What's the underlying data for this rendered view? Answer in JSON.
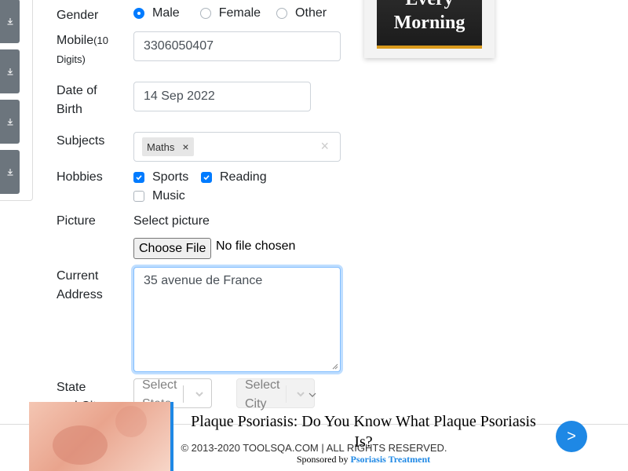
{
  "form": {
    "gender_label": "Gender",
    "gender_options": [
      "Male",
      "Female",
      "Other"
    ],
    "mobile_label": "Mobile",
    "mobile_hint_1": "(10",
    "mobile_hint_2": "Digits)",
    "mobile_value": "3306050407",
    "dob_label_1": "Date of",
    "dob_label_2": "Birth",
    "dob_value": "14 Sep 2022",
    "subjects_label": "Subjects",
    "subject_chip": "Maths",
    "chip_remove": "×",
    "clear_all": "×",
    "hobbies_label": "Hobbies",
    "hobby_sports": "Sports",
    "hobby_reading": "Reading",
    "hobby_music": "Music",
    "picture_label": "Picture",
    "picture_hint": "Select picture",
    "file_button": "Choose File",
    "file_status": "No file chosen",
    "address_label_1": "Current",
    "address_label_2": "Address",
    "address_value": "35 avenue de France",
    "state_label": "State",
    "state_label_2": "and City",
    "state_placeholder_1": "Select",
    "state_placeholder_2": "State",
    "city_placeholder_1": "Select",
    "city_placeholder_2": "City"
  },
  "ad_top": {
    "line1": "Every",
    "line2": "Morning"
  },
  "footer": {
    "copyright": "© 2013-2020 TOOLSQA.COM | ALL RIGHTS RESERVED."
  },
  "ad_bottom": {
    "title": "Plaque Psoriasis: Do You Know What Plaque Psoriasis Is?",
    "sponsored_prefix": "Sponsored by",
    "sponsor": "Psoriasis Treatment",
    "next": ">"
  },
  "colors": {
    "accent": "#007bff",
    "sidebar_button": "#6c757d",
    "ad_accent": "#1e88e5"
  }
}
